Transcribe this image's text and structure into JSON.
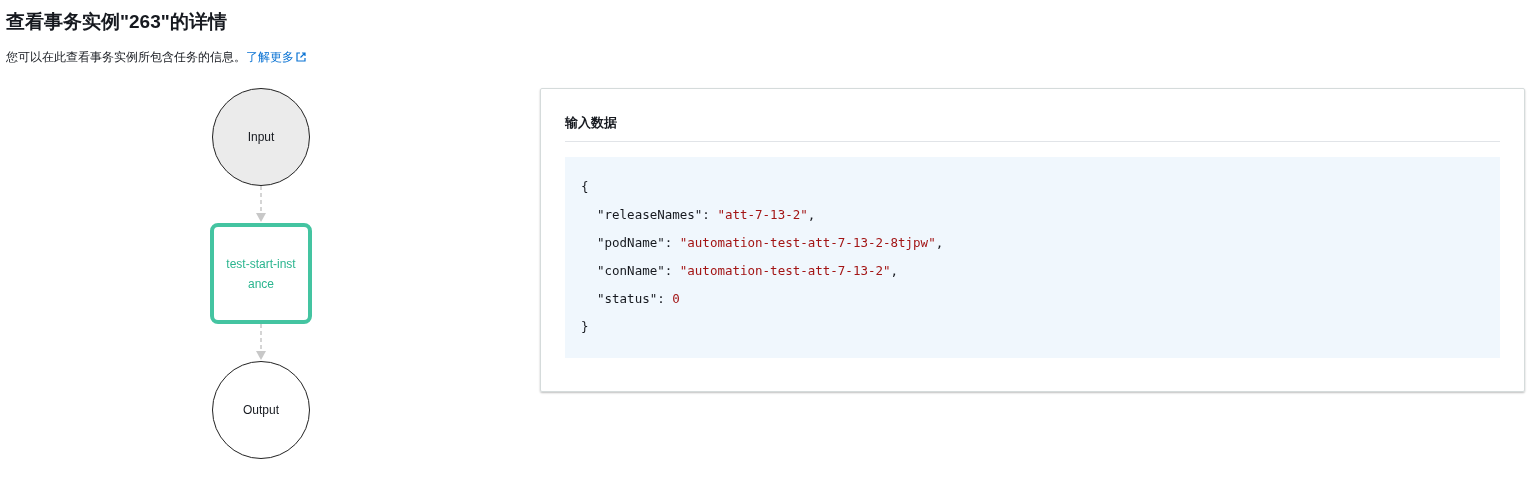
{
  "title": "查看事务实例\"263\"的详情",
  "description": {
    "text": "您可以在此查看事务实例所包含任务的信息。",
    "link": "了解更多"
  },
  "flow": {
    "nodes": [
      {
        "kind": "start",
        "label": "Input"
      },
      {
        "kind": "task",
        "label": "test-start-instance"
      },
      {
        "kind": "end",
        "label": "Output"
      }
    ]
  },
  "input_panel": {
    "heading": "输入数据",
    "code": {
      "open": "{",
      "close": "}",
      "lines": [
        {
          "key": "\"releaseNames\":",
          "value": "\"att-7-13-2\"",
          "suffix": ","
        },
        {
          "key": "\"podName\":",
          "value": "\"automation-test-att-7-13-2-8tjpw\"",
          "suffix": ","
        },
        {
          "key": "\"conName\":",
          "value": "\"automation-test-att-7-13-2\"",
          "suffix": ","
        },
        {
          "key": "\"status\":",
          "value": "0"
        }
      ]
    }
  }
}
